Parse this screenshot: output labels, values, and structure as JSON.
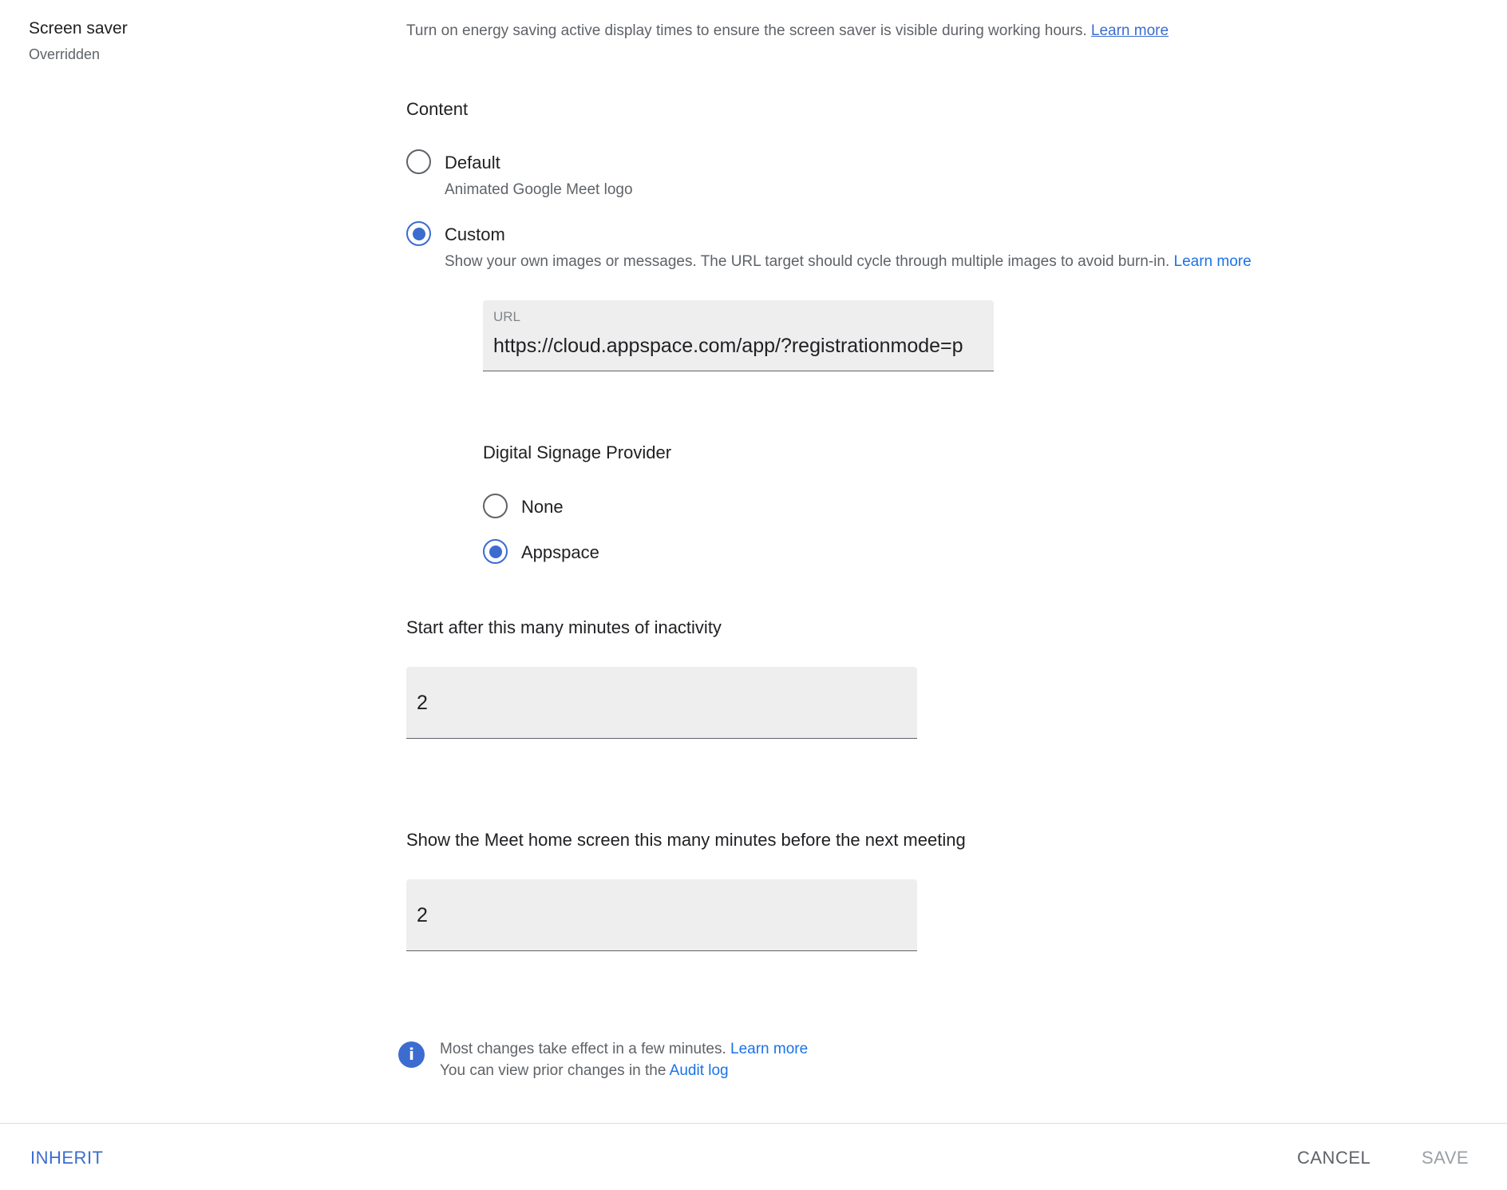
{
  "section": {
    "title": "Screen saver",
    "status": "Overridden"
  },
  "intro": {
    "text": "Turn on energy saving active display times to ensure the screen saver is visible during working hours.",
    "link": "Learn more"
  },
  "content": {
    "heading": "Content",
    "options": [
      {
        "label": "Default",
        "description": "Animated Google Meet logo",
        "selected": false
      },
      {
        "label": "Custom",
        "description": "Show your own images or messages. The URL target should cycle through multiple images to avoid burn-in.",
        "link": "Learn more",
        "selected": true
      }
    ],
    "url_field": {
      "label": "URL",
      "value": "https://cloud.appspace.com/app/?registrationmode=p"
    }
  },
  "signage": {
    "heading": "Digital Signage Provider",
    "options": [
      {
        "label": "None",
        "selected": false
      },
      {
        "label": "Appspace",
        "selected": true
      }
    ]
  },
  "inactivity": {
    "label": "Start after this many minutes of inactivity",
    "value": "2"
  },
  "home_screen": {
    "label": "Show the Meet home screen this many minutes before the next meeting",
    "value": "2"
  },
  "info": {
    "line1": "Most changes take effect in a few minutes.",
    "line1_link": "Learn more",
    "line2": "You can view prior changes in the",
    "line2_link": "Audit log"
  },
  "footer": {
    "inherit": "INHERIT",
    "cancel": "CANCEL",
    "save": "SAVE"
  },
  "colors": {
    "accent": "#3c6ccf",
    "link": "#1a73e8",
    "field_bg": "#eeeeee",
    "muted_text": "#5f6368"
  }
}
